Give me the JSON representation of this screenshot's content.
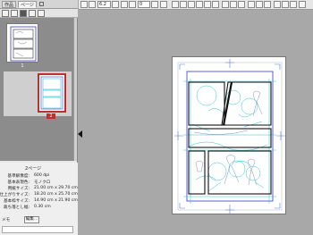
{
  "panel": {
    "tabs": [
      "作品",
      "ページ"
    ],
    "active_tab": 1
  },
  "thumbnails": [
    {
      "label": "1"
    },
    {
      "label": "2"
    }
  ],
  "info": {
    "title": "2ページ",
    "rows": [
      {
        "key": "基準解像度:",
        "value": "600 dpi"
      },
      {
        "key": "基本表現色:",
        "value": "モノクロ"
      },
      {
        "key": "用紙サイズ:",
        "value": "21.00 cm x 29.70 cm"
      },
      {
        "key": "仕上がりサイズ:",
        "value": "18.20 cm x 25.70 cm"
      },
      {
        "key": "基本枠サイズ:",
        "value": "14.90 cm x 21.90 cm"
      },
      {
        "key": "裁ち落とし幅:",
        "value": "0.30 cm"
      }
    ],
    "memo_label": "メモ",
    "edit_label": "編集..."
  },
  "toolbar": {
    "zoom_value": "6.2",
    "angle_value": "0"
  },
  "colors": {
    "selected_border": "#c0302a",
    "frame_blue": "#3b3bc8",
    "guide_cyan": "#29c6d8",
    "sketch_blue": "#5a7ad8"
  }
}
